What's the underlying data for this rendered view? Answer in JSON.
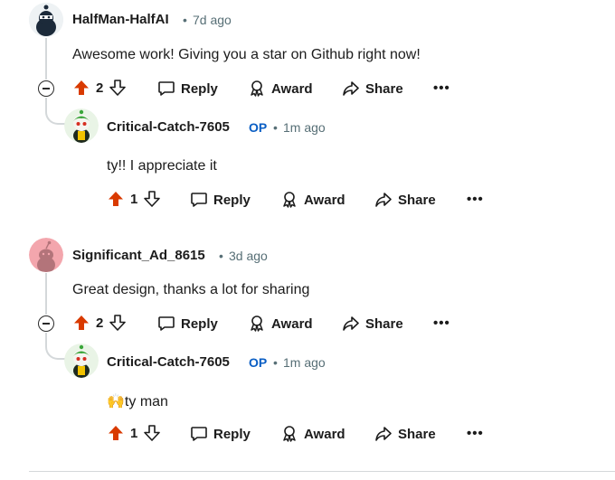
{
  "comments": [
    {
      "username": "HalfMan-HalfAI",
      "time": "7d ago",
      "text": "Awesome work! Giving you a star on Github right now!",
      "votes": "2"
    },
    {
      "username": "Critical-Catch-7605",
      "op": "OP",
      "time": "1m ago",
      "text": "ty!! I appreciate it",
      "votes": "1"
    },
    {
      "username": "Significant_Ad_8615",
      "time": "3d ago",
      "text": "Great design, thanks a lot for sharing",
      "votes": "2"
    },
    {
      "username": "Critical-Catch-7605",
      "op": "OP",
      "time": "1m ago",
      "emoji": "🙌",
      "text": "ty man",
      "votes": "1"
    }
  ],
  "actions": {
    "reply": "Reply",
    "award": "Award",
    "share": "Share",
    "more": "•••",
    "dot": "•"
  },
  "colors": {
    "upvote": "#d93a00",
    "op": "#0a5ec4",
    "meta": "#576f76",
    "thread": "#d4d8da"
  }
}
